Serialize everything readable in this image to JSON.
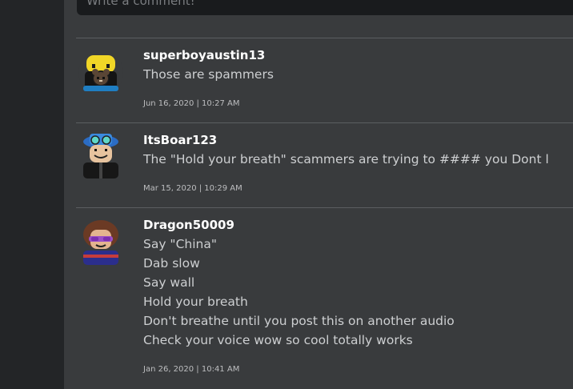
{
  "comment_box": {
    "placeholder": "Write a comment!"
  },
  "comments": [
    {
      "username": "superboyaustin13",
      "lines": [
        "Those are spammers"
      ],
      "timestamp": "Jun 16, 2020 | 10:27 AM"
    },
    {
      "username": "ItsBoar123",
      "lines": [
        "The \"Hold your breath\" scammers are trying to #### you Dont l"
      ],
      "timestamp": "Mar 15, 2020 | 10:29 AM"
    },
    {
      "username": "Dragon50009",
      "lines": [
        "Say \"China\"",
        "Dab slow",
        "Say wall",
        "Hold your breath",
        "Don't breathe until you post this on another audio",
        "Check your voice wow so cool totally works"
      ],
      "timestamp": "Jan 26, 2020 | 10:41 AM"
    }
  ]
}
